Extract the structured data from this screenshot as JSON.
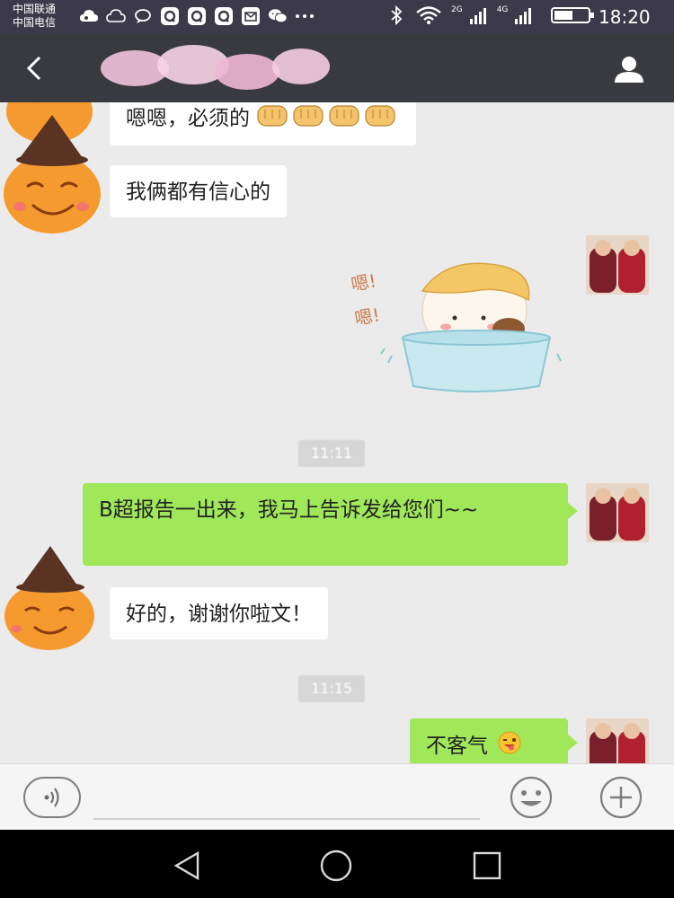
{
  "status_bar": {
    "carrier_1": "中国联通",
    "carrier_2": "中国电信",
    "network_tag_1": "2G",
    "network_tag_2": "4G",
    "time": "18:20",
    "icons": [
      "cloud-icon",
      "weather-icon",
      "chat-bubble-icon",
      "qq-icon",
      "qq-icon",
      "qq-icon",
      "mail-icon",
      "wechat-icon",
      "more-dots-icon",
      "bluetooth-icon",
      "wifi-icon",
      "signal-icon",
      "signal-icon",
      "battery-icon"
    ]
  },
  "header": {
    "contact_name": "",
    "back_icon": "back-arrow-icon",
    "profile_icon": "person-icon"
  },
  "messages": [
    {
      "side": "left",
      "text": "嗯嗯，必须的",
      "emoji": "fist-emoji",
      "emoji_count": 4
    },
    {
      "side": "left",
      "text": "我俩都有信心的"
    },
    {
      "side": "right",
      "type": "sticker",
      "sticker_text_1": "嗯!",
      "sticker_text_2": "嗯!"
    },
    {
      "type": "timestamp",
      "text": "11:11"
    },
    {
      "side": "right",
      "text": "B超报告一出来，我马上告诉发给您们~~"
    },
    {
      "side": "left",
      "text": "好的，谢谢你啦文！"
    },
    {
      "type": "timestamp",
      "text": "11:15"
    },
    {
      "side": "right",
      "text": "不客气",
      "emoji": "wink-tongue-emoji"
    }
  ],
  "input_bar": {
    "voice_icon": "voice-icon",
    "emoji_icon": "smiley-icon",
    "plus_icon": "plus-icon"
  },
  "nav_bar": {
    "back_icon": "nav-back-icon",
    "home_icon": "nav-home-icon",
    "recent_icon": "nav-recent-icon"
  },
  "colors": {
    "status_bar": "#3c3a4a",
    "header": "#393a3f",
    "chat_bg": "#ebebeb",
    "outgoing_bubble": "#a0e75a",
    "incoming_bubble": "#ffffff",
    "timestamp_chip": "#d6d6d6"
  }
}
